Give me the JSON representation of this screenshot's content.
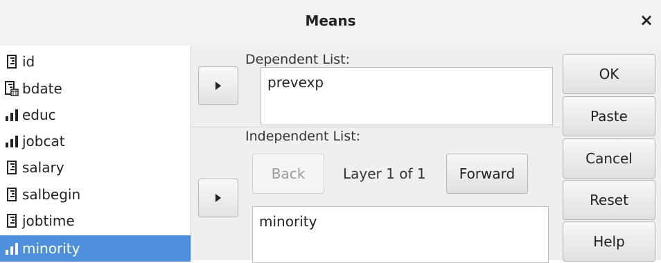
{
  "window": {
    "title": "Means",
    "close_glyph": "×"
  },
  "variables": [
    {
      "name": "id",
      "icon": "scale-ruler-icon"
    },
    {
      "name": "bdate",
      "icon": "date-scale-icon"
    },
    {
      "name": "educ",
      "icon": "ordinal-bars-icon"
    },
    {
      "name": "jobcat",
      "icon": "ordinal-bars-icon"
    },
    {
      "name": "salary",
      "icon": "scale-ruler-icon"
    },
    {
      "name": "salbegin",
      "icon": "scale-ruler-icon"
    },
    {
      "name": "jobtime",
      "icon": "scale-ruler-icon"
    },
    {
      "name": "minority",
      "icon": "ordinal-bars-icon",
      "selected": true
    }
  ],
  "dependent": {
    "label": "Dependent List:",
    "items": [
      "prevexp"
    ]
  },
  "independent": {
    "label": "Independent List:",
    "back_label": "Back",
    "layer_text": "Layer 1 of 1",
    "forward_label": "Forward",
    "items": [
      "minority"
    ]
  },
  "buttons": {
    "ok": "OK",
    "paste": "Paste",
    "cancel": "Cancel",
    "reset": "Reset",
    "help": "Help"
  },
  "colors": {
    "selection": "#4f90dc"
  }
}
